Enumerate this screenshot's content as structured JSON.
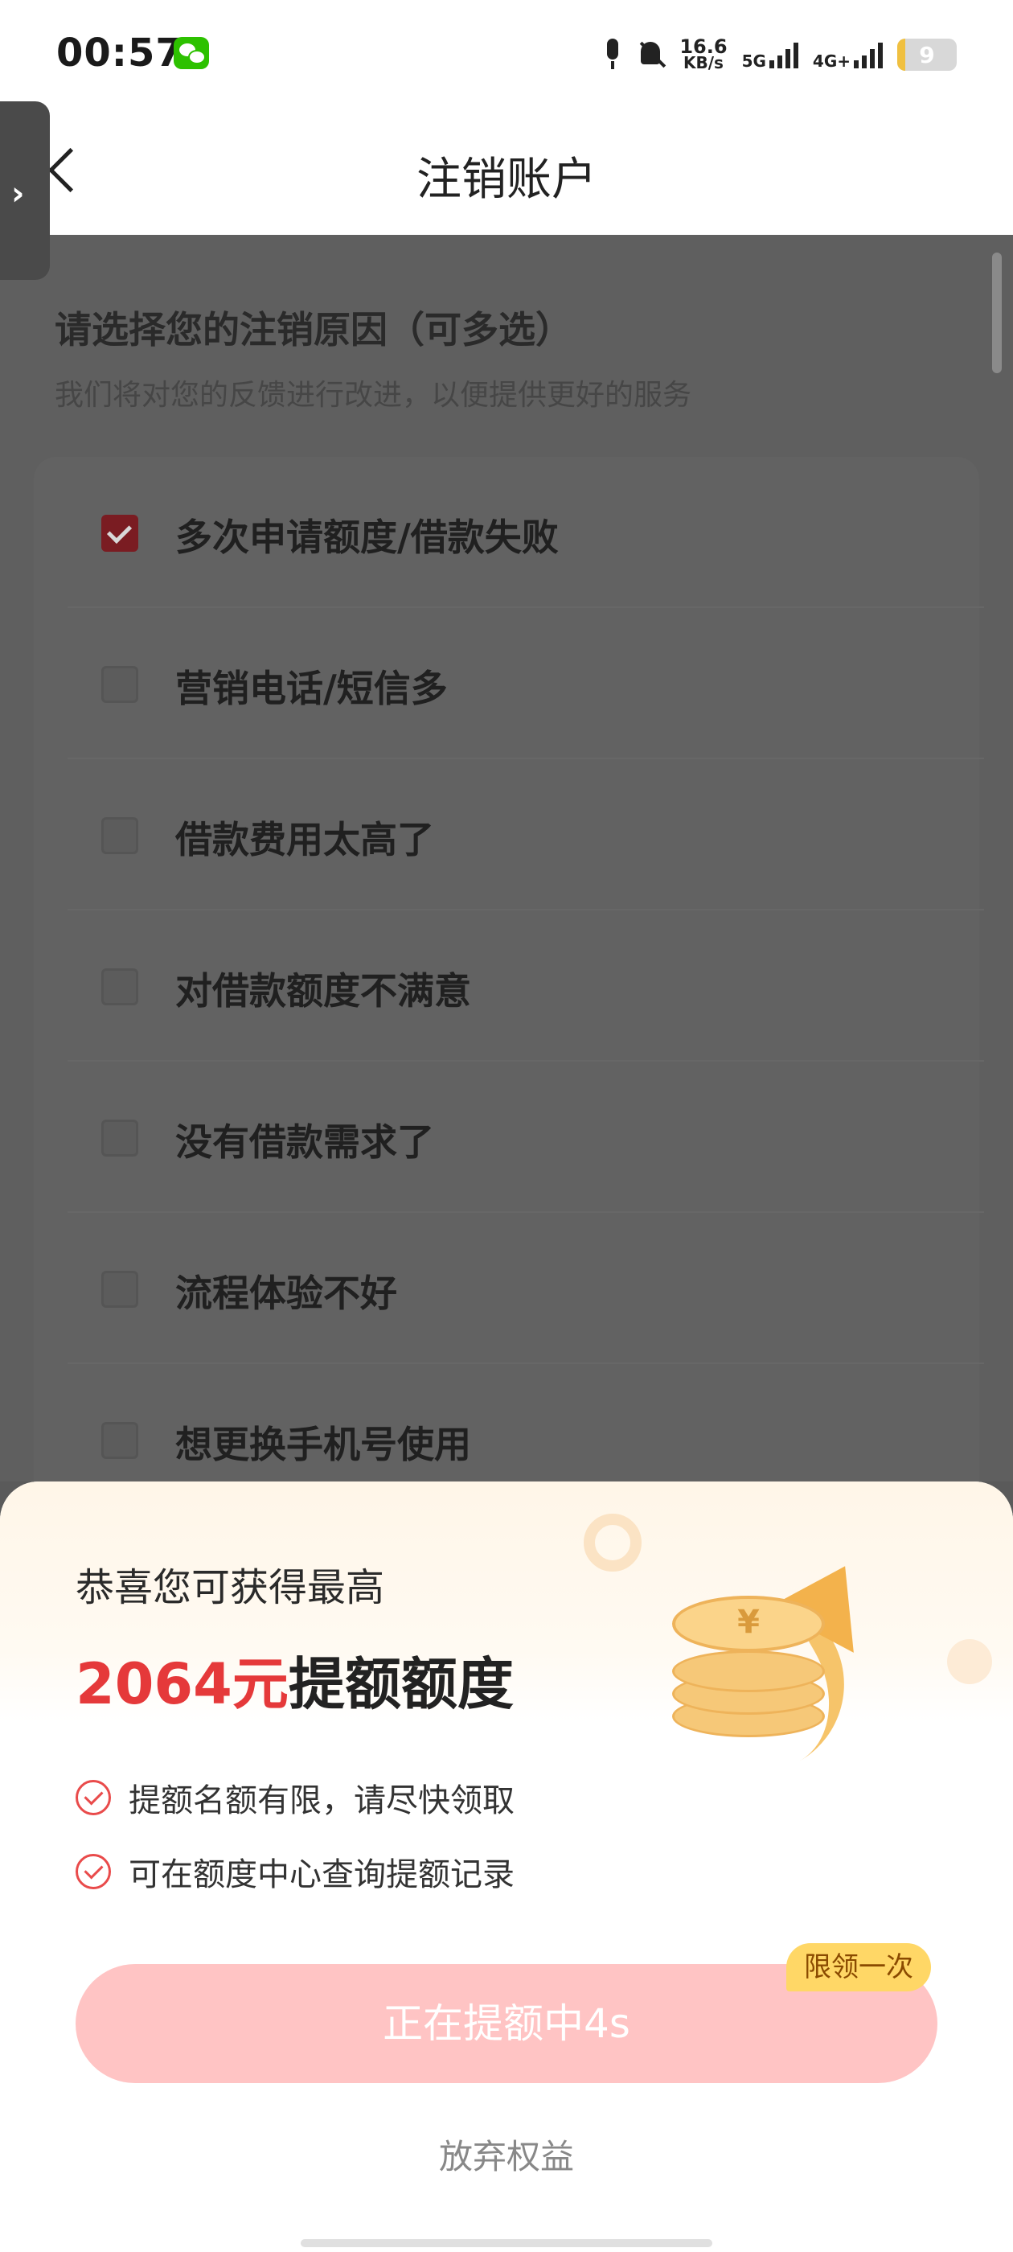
{
  "status_bar": {
    "time": "00:57",
    "speed_value": "16.6",
    "speed_unit": "KB/s",
    "net1": "5G",
    "net2": "4G+",
    "battery": "9"
  },
  "header": {
    "title": "注销账户"
  },
  "reasons": {
    "title": "请选择您的注销原因（可多选）",
    "subtitle": "我们将对您的反馈进行改进，以便提供更好的服务",
    "items": [
      {
        "label": "多次申请额度/借款失败",
        "checked": true
      },
      {
        "label": "营销电话/短信多",
        "checked": false
      },
      {
        "label": "借款费用太高了",
        "checked": false
      },
      {
        "label": "对借款额度不满意",
        "checked": false
      },
      {
        "label": "没有借款需求了",
        "checked": false
      },
      {
        "label": "流程体验不好",
        "checked": false
      },
      {
        "label": "想更换手机号使用",
        "checked": false
      }
    ]
  },
  "sheet": {
    "congrats": "恭喜您可获得最高",
    "amount": "2064元",
    "amount_suffix": "提额额度",
    "benefits": [
      "提额名额有限，请尽快领取",
      "可在额度中心查询提额记录"
    ],
    "cta_label": "正在提额中4s",
    "badge": "限领一次",
    "giveup": "放弃权益"
  },
  "colors": {
    "accent_red": "#e5393a",
    "cta_bg": "#ffc4c4",
    "badge_bg": "#ffd766",
    "check_red": "#e94b4b"
  }
}
